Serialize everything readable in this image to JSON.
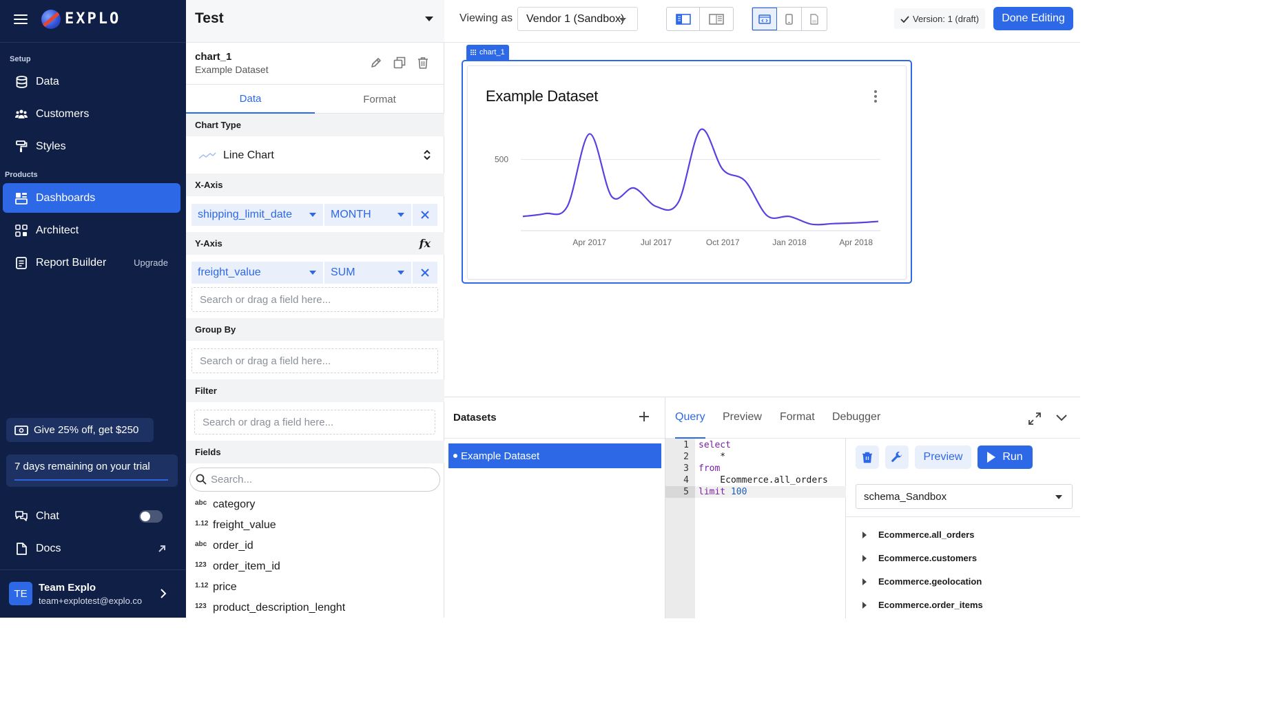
{
  "brand": {
    "name": "EXPLO"
  },
  "nav": {
    "setup_label": "Setup",
    "products_label": "Products",
    "items": [
      {
        "label": "Data",
        "icon": "database-icon"
      },
      {
        "label": "Customers",
        "icon": "users-icon"
      },
      {
        "label": "Styles",
        "icon": "paint-roller-icon"
      },
      {
        "label": "Dashboards",
        "icon": "dashboard-icon",
        "active": true
      },
      {
        "label": "Architect",
        "icon": "architect-icon"
      },
      {
        "label": "Report Builder",
        "icon": "report-icon",
        "extra": "Upgrade"
      }
    ],
    "promo": "Give 25% off, get $250",
    "trial": "7 days remaining on your trial",
    "chat": "Chat",
    "chat_enabled": false,
    "docs": "Docs",
    "user": {
      "initials": "TE",
      "name": "Team Explo",
      "email": "team+explotest@explo.co"
    }
  },
  "editor": {
    "dashboard_title": "Test",
    "chart_id": "chart_1",
    "chart_dataset": "Example Dataset",
    "tabs": [
      "Data",
      "Format"
    ],
    "active_tab": "Data",
    "chart_type_label": "Chart Type",
    "chart_type": "Line Chart",
    "x_axis_label": "X-Axis",
    "x_field": "shipping_limit_date",
    "x_bucket": "MONTH",
    "y_axis_label": "Y-Axis",
    "y_field": "freight_value",
    "y_agg": "SUM",
    "fx": "fx",
    "drop_placeholder": "Search or drag a field here...",
    "group_by_label": "Group By",
    "filter_label": "Filter",
    "fields_label": "Fields",
    "search_placeholder": "Search...",
    "fields": [
      {
        "type": "abc",
        "name": "category"
      },
      {
        "type": "1.12",
        "name": "freight_value"
      },
      {
        "type": "abc",
        "name": "order_id"
      },
      {
        "type": "123",
        "name": "order_item_id"
      },
      {
        "type": "1.12",
        "name": "price"
      },
      {
        "type": "123",
        "name": "product_description_lenght"
      }
    ]
  },
  "toolbar": {
    "viewing_as": "Viewing as",
    "vendor": "Vendor 1 (Sandbox)",
    "version": "Version: 1 (draft)",
    "done": "Done Editing"
  },
  "canvas": {
    "chart_tag": "chart_1",
    "chart_title": "Example Dataset"
  },
  "chart_data": {
    "type": "line",
    "title": "Example Dataset",
    "x_tick_labels": [
      "Apr 2017",
      "Jul 2017",
      "Oct 2017",
      "Jan 2018",
      "Apr 2018"
    ],
    "y_tick_labels": [
      "500"
    ],
    "ylim": [
      0,
      750
    ],
    "grid": true,
    "series": [
      {
        "color": "#5b3fe0",
        "x": [
          "2017-01",
          "2017-02",
          "2017-03",
          "2017-04",
          "2017-05",
          "2017-06",
          "2017-07",
          "2017-08",
          "2017-09",
          "2017-10",
          "2017-11",
          "2017-12",
          "2018-01",
          "2018-02",
          "2018-03",
          "2018-04",
          "2018-05"
        ],
        "values": [
          100,
          120,
          170,
          680,
          240,
          300,
          170,
          200,
          710,
          430,
          350,
          105,
          100,
          45,
          50,
          55,
          65
        ]
      }
    ]
  },
  "bottom": {
    "datasets_title": "Datasets",
    "dataset_item": "Example Dataset",
    "tabs": [
      "Query",
      "Preview",
      "Format",
      "Debugger"
    ],
    "active_tab": "Query",
    "code": [
      "select",
      "    *",
      "from",
      "    Ecommerce.all_orders",
      "limit 100"
    ],
    "preview": "Preview",
    "run": "Run",
    "schema": "schema_Sandbox",
    "tables": [
      "Ecommerce.all_orders",
      "Ecommerce.customers",
      "Ecommerce.geolocation",
      "Ecommerce.order_items"
    ]
  }
}
